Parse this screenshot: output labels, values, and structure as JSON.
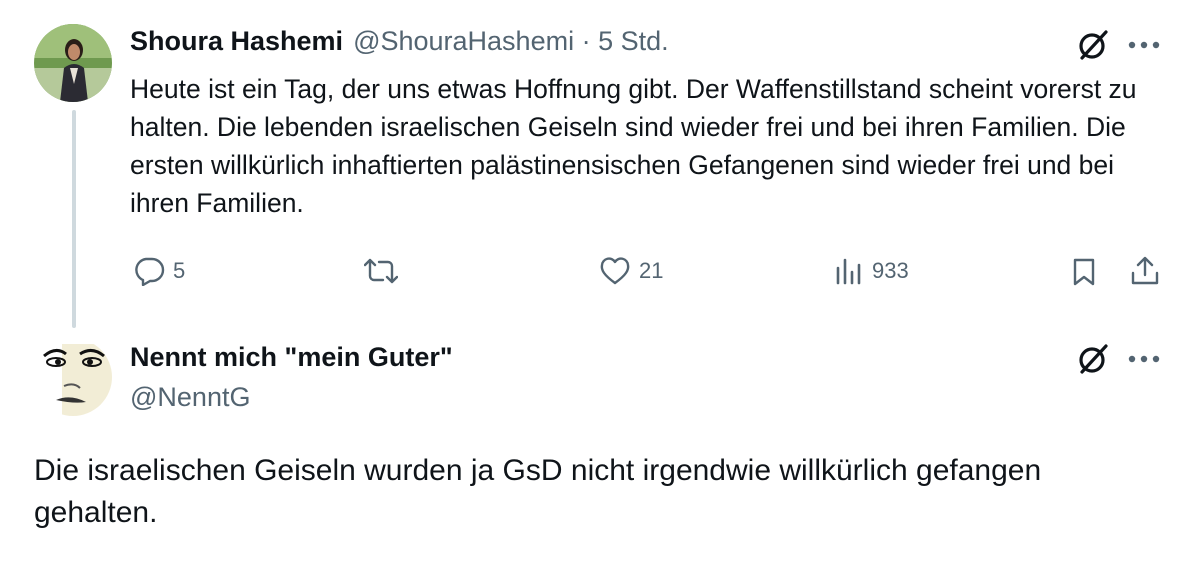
{
  "tweet": {
    "author_name": "Shoura Hashemi",
    "handle_time": "@ShouraHashemi · 5 Std.",
    "text": "Heute ist ein Tag, der uns etwas Hoffnung gibt. Der Waffenstillstand scheint vorerst zu halten. Die lebenden israelischen Geiseln sind wieder frei und bei ihren Familien. Die ersten willkürlich inhaftierten palästinensischen Gefangenen sind wieder frei und bei ihren Familien.",
    "replies": "5",
    "likes": "21",
    "views": "933"
  },
  "reply": {
    "author_name": "Nennt mich \"mein Guter\"",
    "handle": "@NenntG",
    "text": "Die israelischen Geiseln wurden ja GsD nicht irgendwie willkürlich gefangen gehalten."
  },
  "icons": {
    "grok": "grok-icon",
    "more": "more-icon",
    "reply": "reply-icon",
    "retweet": "retweet-icon",
    "like": "like-icon",
    "views": "views-icon",
    "bookmark": "bookmark-icon",
    "share": "share-icon"
  },
  "colors": {
    "text": "#0f1419",
    "secondary": "#536471",
    "thread_line": "#cfd9de"
  }
}
